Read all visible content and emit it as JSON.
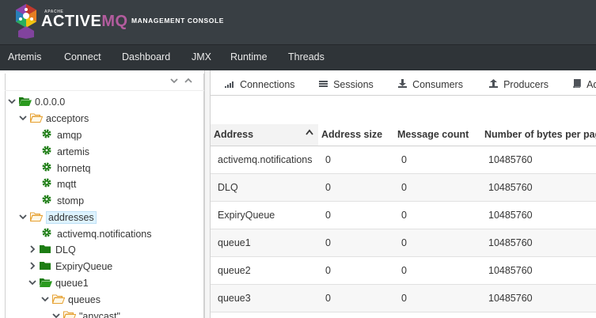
{
  "header": {
    "brand_small": "APACHE",
    "brand_active": "ACTIVE",
    "brand_mq": "MQ",
    "subtitle": "MANAGEMENT CONSOLE",
    "colors": {
      "header_bg": "#393f44",
      "nav_bg": "#2f3438",
      "mq_accent": "#b35c9e"
    }
  },
  "nav": {
    "items": [
      "Artemis",
      "Connect",
      "Dashboard",
      "JMX",
      "Runtime",
      "Threads"
    ]
  },
  "tree": {
    "collapse_icon": "chevron-down-icon",
    "expand_icon": "chevron-up-icon",
    "nodes": [
      {
        "label": "0.0.0.0",
        "icon": "folder-open-green-icon",
        "state": "expanded"
      },
      {
        "label": "acceptors",
        "icon": "folder-open-icon",
        "state": "expanded"
      },
      {
        "label": "amqp",
        "icon": "gear-icon",
        "state": "leaf"
      },
      {
        "label": "artemis",
        "icon": "gear-icon",
        "state": "leaf"
      },
      {
        "label": "hornetq",
        "icon": "gear-icon",
        "state": "leaf"
      },
      {
        "label": "mqtt",
        "icon": "gear-icon",
        "state": "leaf"
      },
      {
        "label": "stomp",
        "icon": "gear-icon",
        "state": "leaf"
      },
      {
        "label": "addresses",
        "icon": "folder-open-icon",
        "state": "expanded",
        "selected": true
      },
      {
        "label": "activemq.notifications",
        "icon": "gear-icon",
        "state": "leaf"
      },
      {
        "label": "DLQ",
        "icon": "folder-green-icon",
        "state": "collapsed"
      },
      {
        "label": "ExpiryQueue",
        "icon": "folder-green-icon",
        "state": "collapsed"
      },
      {
        "label": "queue1",
        "icon": "folder-open-green-icon",
        "state": "expanded"
      },
      {
        "label": "queues",
        "icon": "folder-open-icon",
        "state": "expanded"
      },
      {
        "label": "\"anycast\"",
        "icon": "folder-open-icon",
        "state": "expanded"
      }
    ]
  },
  "tabs": [
    {
      "label": "Connections",
      "icon": "signal-bars-icon"
    },
    {
      "label": "Sessions",
      "icon": "list-icon"
    },
    {
      "label": "Consumers",
      "icon": "download-icon"
    },
    {
      "label": "Producers",
      "icon": "upload-icon"
    },
    {
      "label": "Ad",
      "icon": "book-icon"
    }
  ],
  "table": {
    "columns": [
      "Address",
      "Address size",
      "Message count",
      "Number of bytes per page"
    ],
    "rows": [
      [
        "activemq.notifications",
        "0",
        "0",
        "10485760"
      ],
      [
        "DLQ",
        "0",
        "0",
        "10485760"
      ],
      [
        "ExpiryQueue",
        "0",
        "0",
        "10485760"
      ],
      [
        "queue1",
        "0",
        "0",
        "10485760"
      ],
      [
        "queue2",
        "0",
        "0",
        "10485760"
      ],
      [
        "queue3",
        "0",
        "0",
        "10485760"
      ]
    ]
  }
}
